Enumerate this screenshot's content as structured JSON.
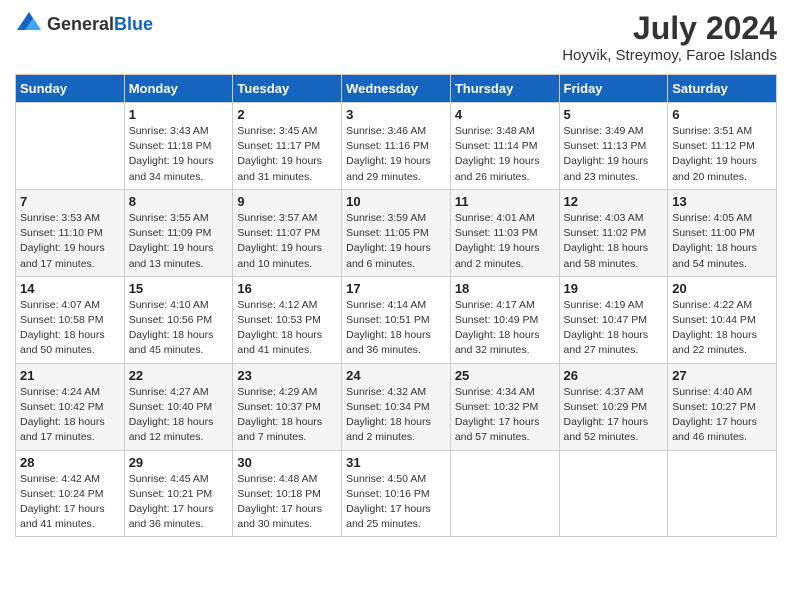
{
  "header": {
    "logo_general": "General",
    "logo_blue": "Blue",
    "month_title": "July 2024",
    "location": "Hoyvik, Streymoy, Faroe Islands"
  },
  "weekdays": [
    "Sunday",
    "Monday",
    "Tuesday",
    "Wednesday",
    "Thursday",
    "Friday",
    "Saturday"
  ],
  "weeks": [
    [
      {
        "day": "",
        "info": ""
      },
      {
        "day": "1",
        "info": "Sunrise: 3:43 AM\nSunset: 11:18 PM\nDaylight: 19 hours and 34 minutes."
      },
      {
        "day": "2",
        "info": "Sunrise: 3:45 AM\nSunset: 11:17 PM\nDaylight: 19 hours and 31 minutes."
      },
      {
        "day": "3",
        "info": "Sunrise: 3:46 AM\nSunset: 11:16 PM\nDaylight: 19 hours and 29 minutes."
      },
      {
        "day": "4",
        "info": "Sunrise: 3:48 AM\nSunset: 11:14 PM\nDaylight: 19 hours and 26 minutes."
      },
      {
        "day": "5",
        "info": "Sunrise: 3:49 AM\nSunset: 11:13 PM\nDaylight: 19 hours and 23 minutes."
      },
      {
        "day": "6",
        "info": "Sunrise: 3:51 AM\nSunset: 11:12 PM\nDaylight: 19 hours and 20 minutes."
      }
    ],
    [
      {
        "day": "7",
        "info": "Sunrise: 3:53 AM\nSunset: 11:10 PM\nDaylight: 19 hours and 17 minutes."
      },
      {
        "day": "8",
        "info": "Sunrise: 3:55 AM\nSunset: 11:09 PM\nDaylight: 19 hours and 13 minutes."
      },
      {
        "day": "9",
        "info": "Sunrise: 3:57 AM\nSunset: 11:07 PM\nDaylight: 19 hours and 10 minutes."
      },
      {
        "day": "10",
        "info": "Sunrise: 3:59 AM\nSunset: 11:05 PM\nDaylight: 19 hours and 6 minutes."
      },
      {
        "day": "11",
        "info": "Sunrise: 4:01 AM\nSunset: 11:03 PM\nDaylight: 19 hours and 2 minutes."
      },
      {
        "day": "12",
        "info": "Sunrise: 4:03 AM\nSunset: 11:02 PM\nDaylight: 18 hours and 58 minutes."
      },
      {
        "day": "13",
        "info": "Sunrise: 4:05 AM\nSunset: 11:00 PM\nDaylight: 18 hours and 54 minutes."
      }
    ],
    [
      {
        "day": "14",
        "info": "Sunrise: 4:07 AM\nSunset: 10:58 PM\nDaylight: 18 hours and 50 minutes."
      },
      {
        "day": "15",
        "info": "Sunrise: 4:10 AM\nSunset: 10:56 PM\nDaylight: 18 hours and 45 minutes."
      },
      {
        "day": "16",
        "info": "Sunrise: 4:12 AM\nSunset: 10:53 PM\nDaylight: 18 hours and 41 minutes."
      },
      {
        "day": "17",
        "info": "Sunrise: 4:14 AM\nSunset: 10:51 PM\nDaylight: 18 hours and 36 minutes."
      },
      {
        "day": "18",
        "info": "Sunrise: 4:17 AM\nSunset: 10:49 PM\nDaylight: 18 hours and 32 minutes."
      },
      {
        "day": "19",
        "info": "Sunrise: 4:19 AM\nSunset: 10:47 PM\nDaylight: 18 hours and 27 minutes."
      },
      {
        "day": "20",
        "info": "Sunrise: 4:22 AM\nSunset: 10:44 PM\nDaylight: 18 hours and 22 minutes."
      }
    ],
    [
      {
        "day": "21",
        "info": "Sunrise: 4:24 AM\nSunset: 10:42 PM\nDaylight: 18 hours and 17 minutes."
      },
      {
        "day": "22",
        "info": "Sunrise: 4:27 AM\nSunset: 10:40 PM\nDaylight: 18 hours and 12 minutes."
      },
      {
        "day": "23",
        "info": "Sunrise: 4:29 AM\nSunset: 10:37 PM\nDaylight: 18 hours and 7 minutes."
      },
      {
        "day": "24",
        "info": "Sunrise: 4:32 AM\nSunset: 10:34 PM\nDaylight: 18 hours and 2 minutes."
      },
      {
        "day": "25",
        "info": "Sunrise: 4:34 AM\nSunset: 10:32 PM\nDaylight: 17 hours and 57 minutes."
      },
      {
        "day": "26",
        "info": "Sunrise: 4:37 AM\nSunset: 10:29 PM\nDaylight: 17 hours and 52 minutes."
      },
      {
        "day": "27",
        "info": "Sunrise: 4:40 AM\nSunset: 10:27 PM\nDaylight: 17 hours and 46 minutes."
      }
    ],
    [
      {
        "day": "28",
        "info": "Sunrise: 4:42 AM\nSunset: 10:24 PM\nDaylight: 17 hours and 41 minutes."
      },
      {
        "day": "29",
        "info": "Sunrise: 4:45 AM\nSunset: 10:21 PM\nDaylight: 17 hours and 36 minutes."
      },
      {
        "day": "30",
        "info": "Sunrise: 4:48 AM\nSunset: 10:18 PM\nDaylight: 17 hours and 30 minutes."
      },
      {
        "day": "31",
        "info": "Sunrise: 4:50 AM\nSunset: 10:16 PM\nDaylight: 17 hours and 25 minutes."
      },
      {
        "day": "",
        "info": ""
      },
      {
        "day": "",
        "info": ""
      },
      {
        "day": "",
        "info": ""
      }
    ]
  ]
}
